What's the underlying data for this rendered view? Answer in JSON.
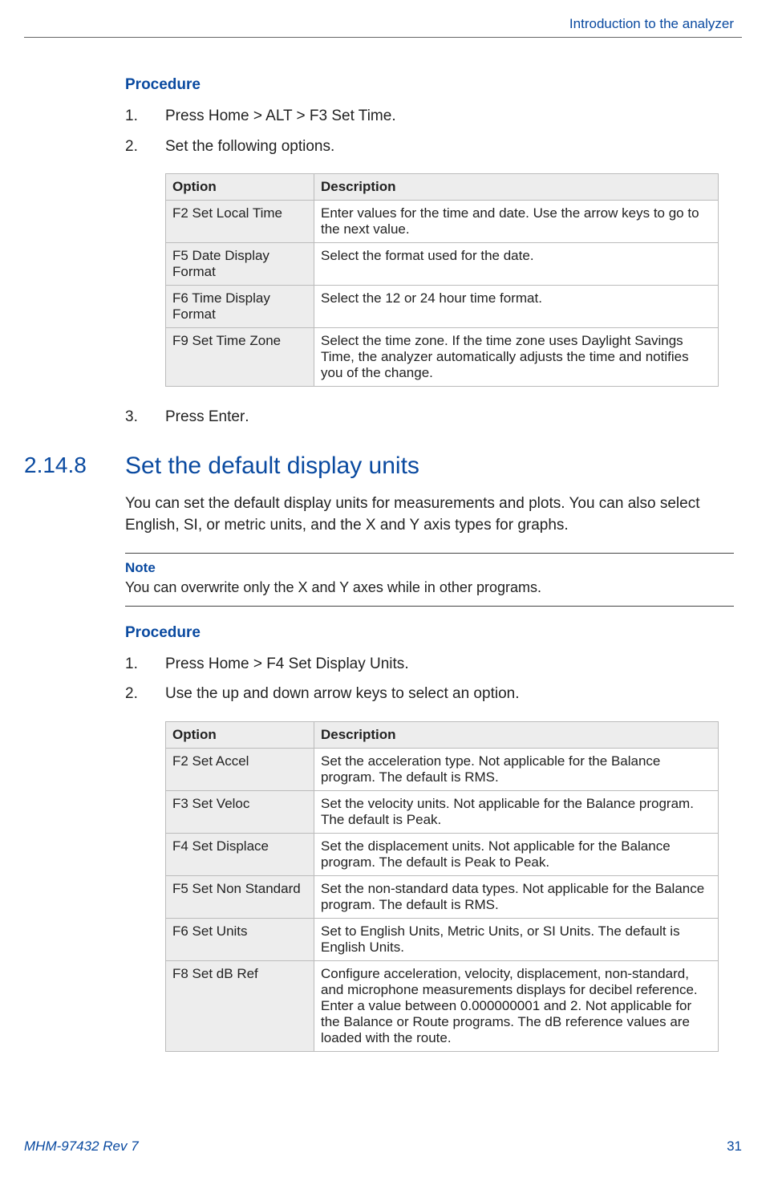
{
  "runningHead": "Introduction to the analyzer",
  "proc1": {
    "label": "Procedure",
    "steps": [
      {
        "n": "1.",
        "pre": "Press ",
        "kbd": "Home > ALT > F3 Set Time",
        "post": "."
      },
      {
        "n": "2.",
        "pre": "Set the following options.",
        "kbd": "",
        "post": ""
      },
      {
        "n": "3.",
        "pre": "Press ",
        "kbd": "Enter",
        "post": "."
      }
    ]
  },
  "table1": {
    "h1": "Option",
    "h2": "Description",
    "rows": [
      {
        "opt": "F2 Set Local Time",
        "seg": [
          [
            "t",
            "Enter values for the time and date. Use the arrow keys to go to the next value."
          ]
        ]
      },
      {
        "opt": "F5 Date Display Format",
        "seg": [
          [
            "t",
            "Select the format used for the date."
          ]
        ]
      },
      {
        "opt": "F6 Time Display Format",
        "seg": [
          [
            "t",
            "Select the 12 or 24 hour time format."
          ]
        ]
      },
      {
        "opt": "F9 Set Time Zone",
        "seg": [
          [
            "t",
            "Select the time zone. If the time zone uses Daylight Savings Time, the analyzer automatically adjusts the time and notifies you of the change."
          ]
        ]
      }
    ]
  },
  "section": {
    "num": "2.14.8",
    "title": "Set the default display units",
    "para": "You can set the default display units for measurements and plots. You can also select English, SI, or metric units, and the X and Y axis types for graphs."
  },
  "note": {
    "label": "Note",
    "text": "You can overwrite only the X and Y axes while in other programs."
  },
  "proc2": {
    "label": "Procedure",
    "steps": [
      {
        "n": "1.",
        "pre": "Press ",
        "kbd": "Home > F4 Set Display Units",
        "post": "."
      },
      {
        "n": "2.",
        "pre": "Use the up and down arrow keys to select an option.",
        "kbd": "",
        "post": ""
      }
    ]
  },
  "table2": {
    "h1": "Option",
    "h2": "Description",
    "rows": [
      {
        "opt": "F2 Set Accel",
        "seg": [
          [
            "t",
            "Set the acceleration type. Not applicable for the "
          ],
          [
            "u",
            "Balance"
          ],
          [
            "t",
            " program. The default is "
          ],
          [
            "u",
            "RMS"
          ],
          [
            "t",
            "."
          ]
        ]
      },
      {
        "opt": "F3 Set Veloc",
        "seg": [
          [
            "t",
            "Set the velocity units. Not applicable for the "
          ],
          [
            "u",
            "Balance"
          ],
          [
            "t",
            " program. The default is "
          ],
          [
            "u",
            "Peak"
          ],
          [
            "t",
            "."
          ]
        ]
      },
      {
        "opt": "F4 Set Displace",
        "seg": [
          [
            "t",
            "Set the displacement units. Not applicable for the "
          ],
          [
            "u",
            "Balance"
          ],
          [
            "t",
            " program. The default is "
          ],
          [
            "u",
            "Peak to Peak"
          ],
          [
            "t",
            "."
          ]
        ]
      },
      {
        "opt": "F5 Set Non Standard",
        "seg": [
          [
            "t",
            "Set the non-standard data types. Not applicable for the "
          ],
          [
            "u",
            "Balance"
          ],
          [
            "t",
            " program. The default is "
          ],
          [
            "u",
            "RMS"
          ],
          [
            "t",
            "."
          ]
        ]
      },
      {
        "opt": "F6 Set Units",
        "seg": [
          [
            "t",
            "Set to "
          ],
          [
            "u",
            "English Units"
          ],
          [
            "t",
            ", "
          ],
          [
            "u",
            "Metric Units"
          ],
          [
            "t",
            ", or "
          ],
          [
            "u",
            "SI Units"
          ],
          [
            "t",
            ". The default is "
          ],
          [
            "u",
            "English Units"
          ],
          [
            "t",
            "."
          ]
        ]
      },
      {
        "opt": "F8 Set dB Ref",
        "seg": [
          [
            "t",
            "Configure acceleration, velocity, displacement, non-standard, and microphone measurements displays for decibel reference. Enter a value between 0.000000001 and 2. Not applicable for the "
          ],
          [
            "u",
            "Balance"
          ],
          [
            "t",
            " or "
          ],
          [
            "u",
            "Route"
          ],
          [
            "t",
            " programs. The dB reference values are loaded with the route."
          ]
        ]
      }
    ]
  },
  "footer": {
    "left": "MHM-97432 Rev 7",
    "right": "31"
  }
}
